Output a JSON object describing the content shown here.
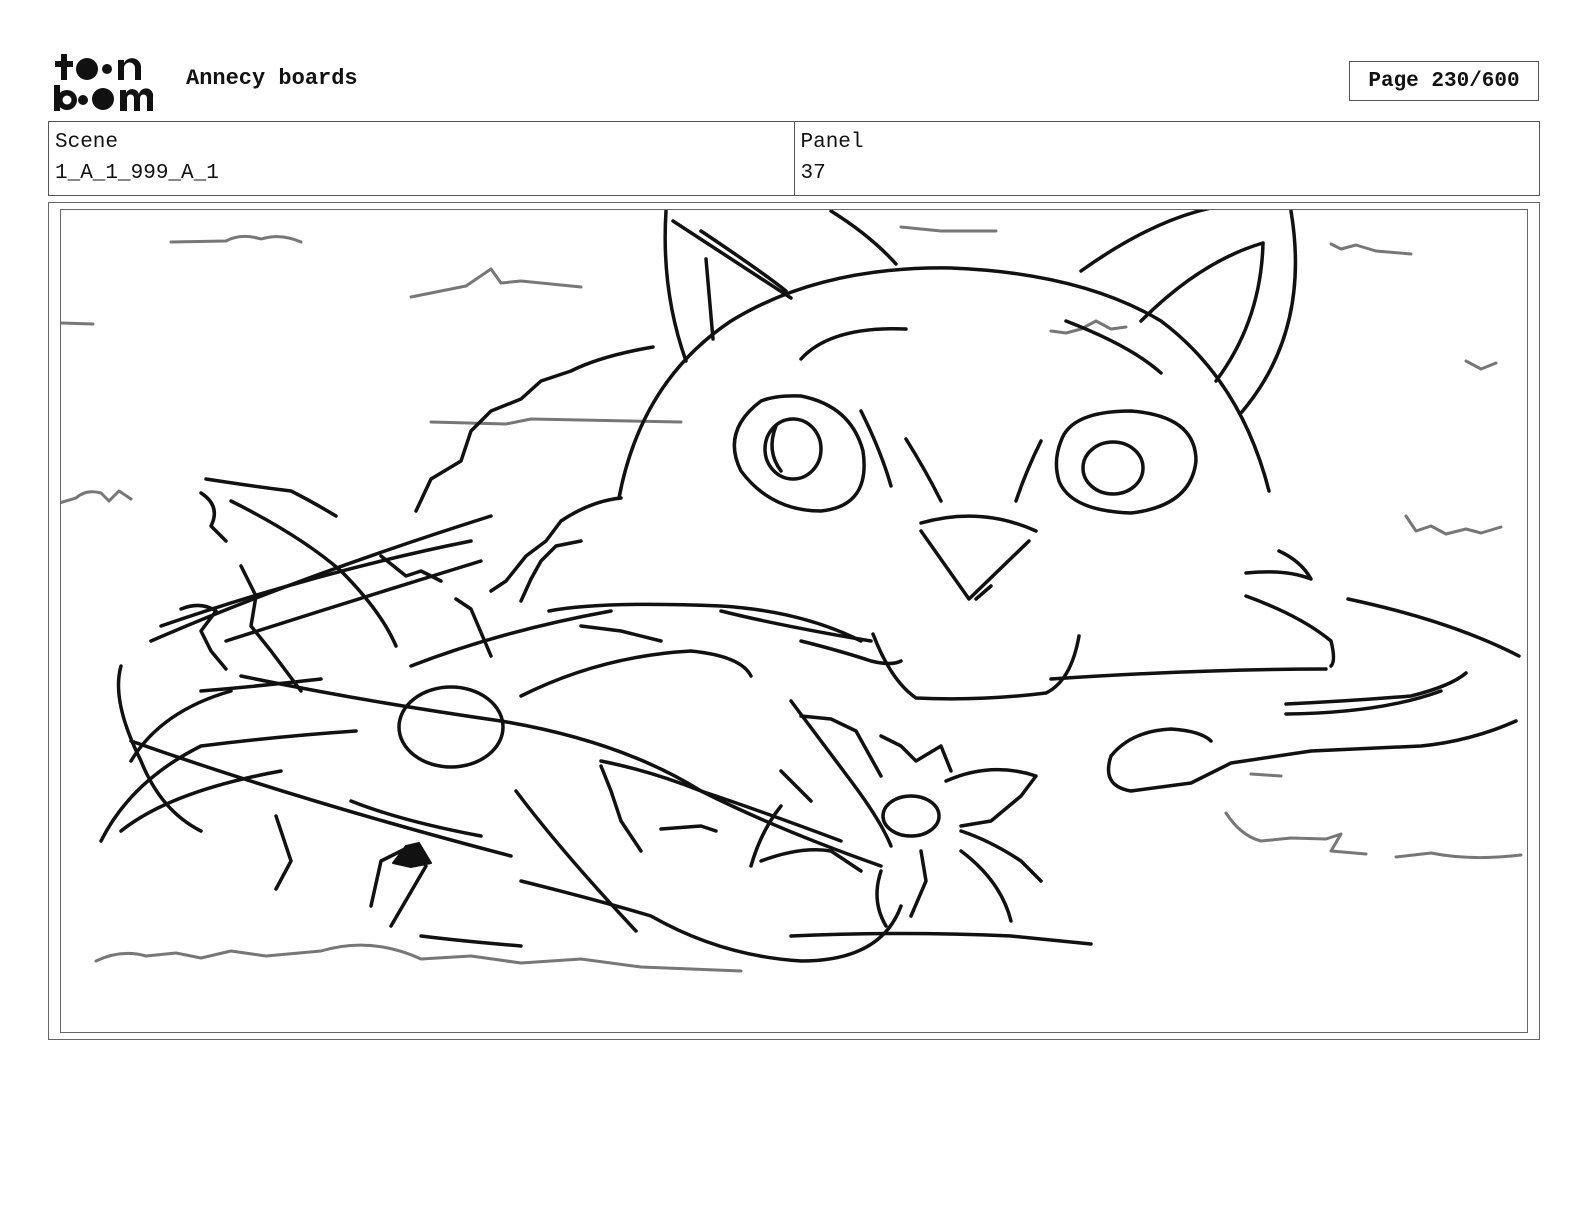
{
  "header": {
    "logo_text": "toon boom",
    "project_title": "Annecy boards",
    "page_label": "Page 230/600"
  },
  "info": {
    "scene_label": "Scene",
    "scene_value": "1_A_1_999_A_1",
    "panel_label": "Panel",
    "panel_value": "37"
  },
  "sketch": {
    "description_icon": "storyboard-sketch-cat-in-water-with-flower",
    "line_color": "#111111",
    "water_color": "#777777"
  }
}
